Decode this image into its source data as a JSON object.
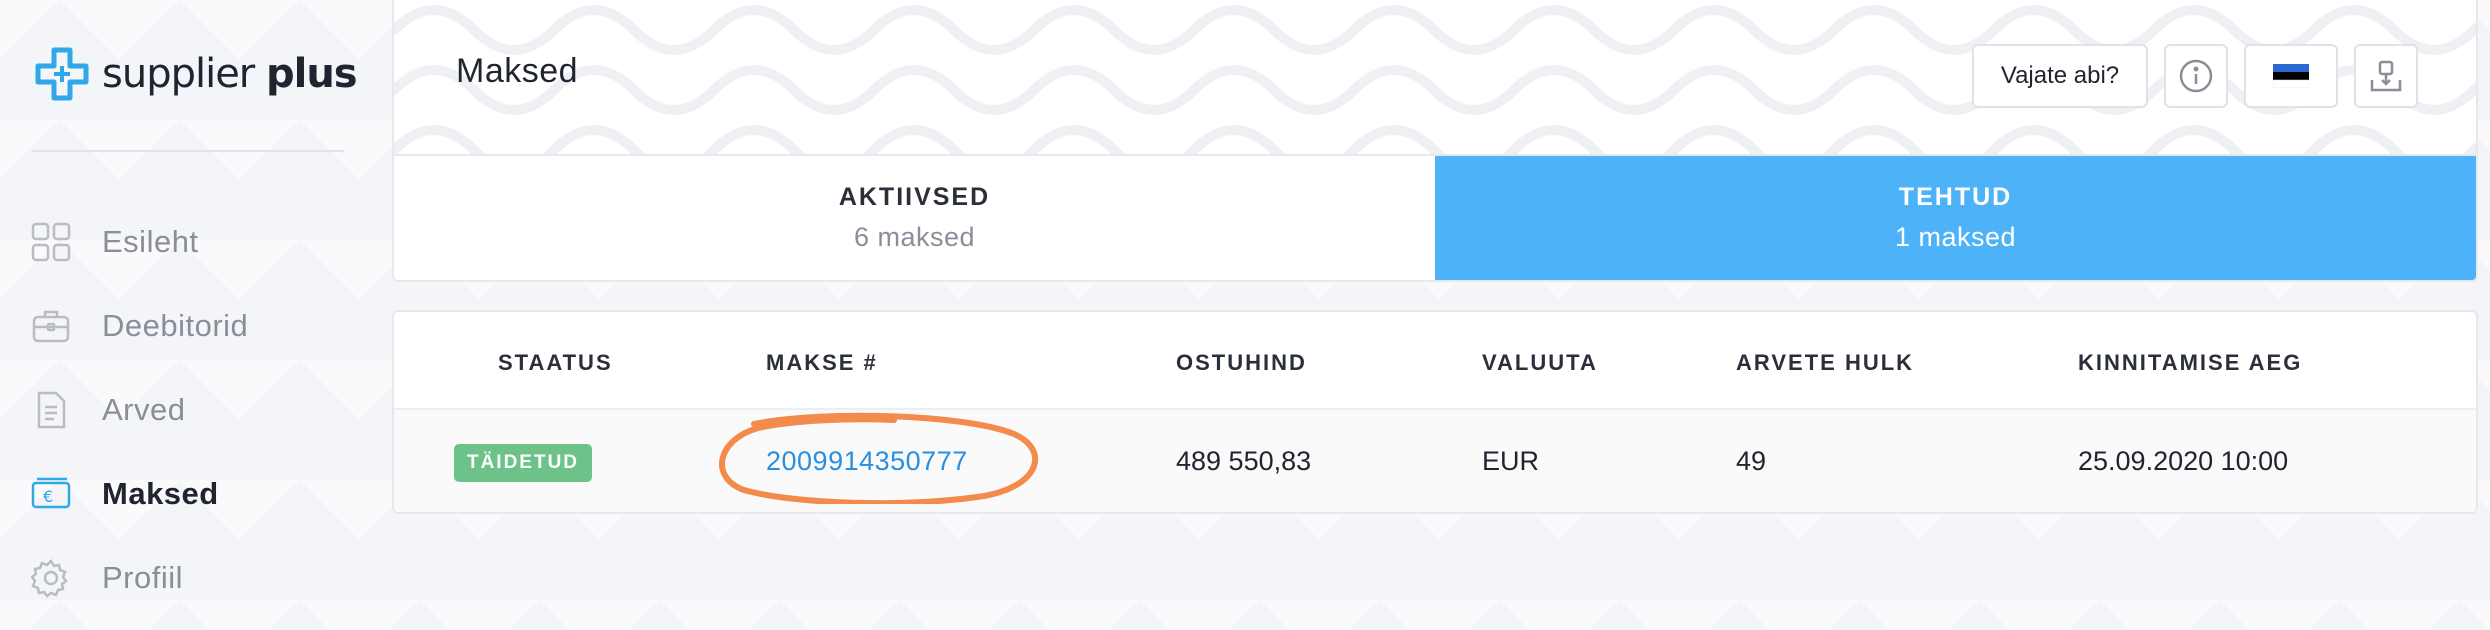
{
  "app": {
    "logo_regular": "supplier",
    "logo_bold": "plus"
  },
  "sidebar": {
    "items": [
      {
        "label": "Esileht",
        "icon": "grid-icon",
        "active": false
      },
      {
        "label": "Deebitorid",
        "icon": "briefcase-icon",
        "active": false
      },
      {
        "label": "Arved",
        "icon": "document-icon",
        "active": false
      },
      {
        "label": "Maksed",
        "icon": "euro-card-icon",
        "active": true
      },
      {
        "label": "Profiil",
        "icon": "gear-icon",
        "active": false
      }
    ]
  },
  "header": {
    "title": "Maksed",
    "help_label": "Vajate abi?",
    "info_icon": "info-icon",
    "flag_icon": "estonia-flag-icon",
    "logout_icon": "logout-icon"
  },
  "tabs": [
    {
      "label": "AKTIIVSED",
      "count": "6 maksed",
      "active": false
    },
    {
      "label": "TEHTUD",
      "count": "1 maksed",
      "active": true
    }
  ],
  "table": {
    "columns": [
      "STAATUS",
      "MAKSE #",
      "OSTUHIND",
      "VALUUTA",
      "ARVETE HULK",
      "KINNITAMISE AEG"
    ],
    "rows": [
      {
        "status": "TÄIDETUD",
        "payment_no": "2009914350777",
        "price": "489 550,83",
        "currency": "EUR",
        "invoice_count": "49",
        "confirmed_at": "25.09.2020 10:00"
      }
    ]
  },
  "colors": {
    "accent": "#4db2f8",
    "status_done": "#6cc288",
    "link": "#2a8fe0",
    "annotation": "#f28b4b",
    "logo": "#2fa8e6"
  }
}
